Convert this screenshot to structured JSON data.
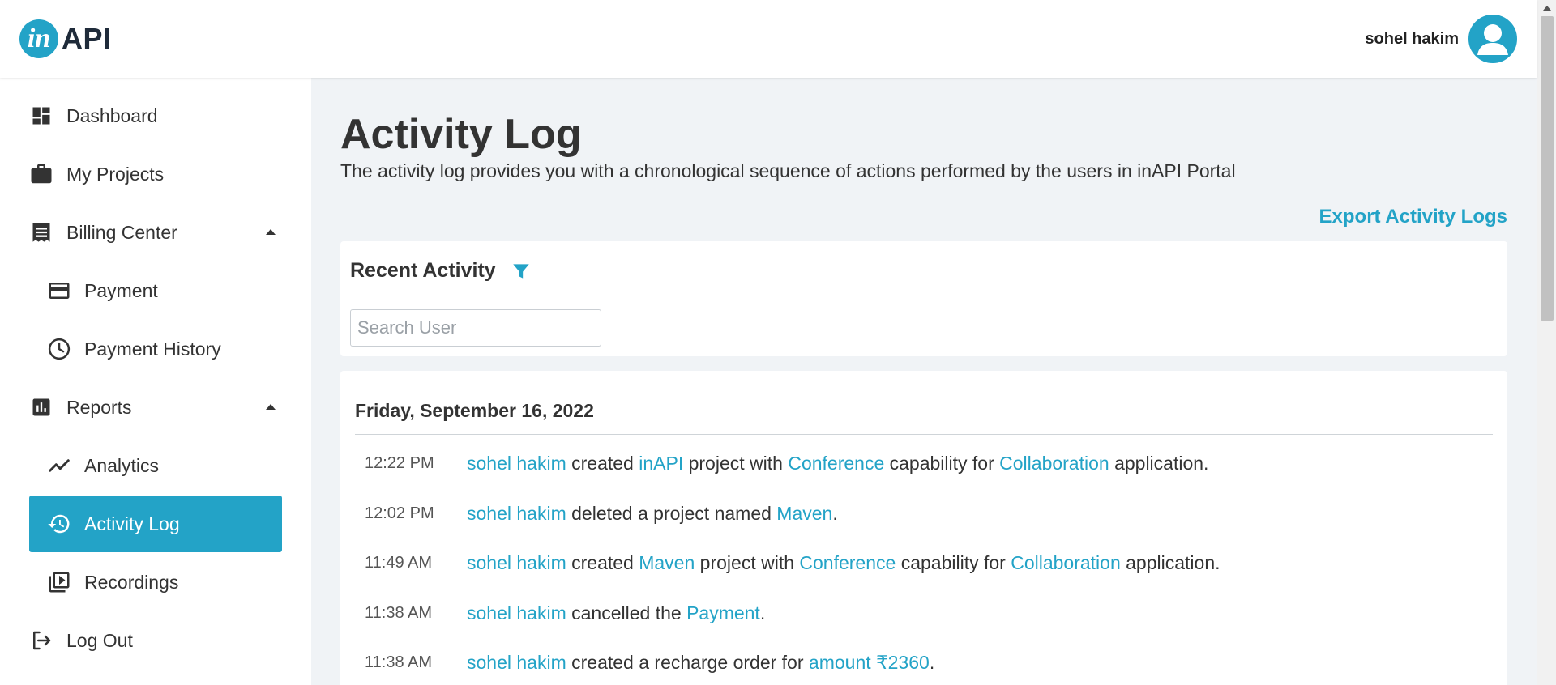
{
  "brand": {
    "logo_mark": "in",
    "logo_text": "API",
    "accent_color": "#23a3c7"
  },
  "user": {
    "name": "sohel hakim"
  },
  "sidebar": {
    "items": [
      {
        "label": "Dashboard",
        "icon": "dashboard-icon"
      },
      {
        "label": "My Projects",
        "icon": "briefcase-icon"
      },
      {
        "label": "Billing Center",
        "icon": "receipt-icon",
        "expanded": true
      },
      {
        "label": "Payment",
        "icon": "credit-card-icon"
      },
      {
        "label": "Payment History",
        "icon": "clock-icon"
      },
      {
        "label": "Reports",
        "icon": "bar-chart-icon",
        "expanded": true
      },
      {
        "label": "Analytics",
        "icon": "trend-line-icon"
      },
      {
        "label": "Activity Log",
        "icon": "history-icon",
        "active": true
      },
      {
        "label": "Recordings",
        "icon": "video-library-icon"
      },
      {
        "label": "Log Out",
        "icon": "logout-icon"
      }
    ]
  },
  "page": {
    "title": "Activity Log",
    "description": "The activity log provides you with a chronological sequence of actions performed by the users in inAPI Portal",
    "export_label": "Export Activity Logs"
  },
  "filter": {
    "title": "Recent Activity",
    "search_placeholder": "Search User"
  },
  "log": {
    "date": "Friday, September 16, 2022",
    "entries": [
      {
        "time": "12:22 PM",
        "parts": [
          "sohel hakim",
          " created ",
          "inAPI",
          " project with ",
          "Conference",
          " capability for ",
          "Collaboration",
          " application."
        ]
      },
      {
        "time": "12:02 PM",
        "parts": [
          "sohel hakim",
          " deleted a project named ",
          "Maven",
          "."
        ]
      },
      {
        "time": "11:49 AM",
        "parts": [
          "sohel hakim",
          " created ",
          "Maven",
          " project with ",
          "Conference",
          " capability for ",
          "Collaboration",
          " application."
        ]
      },
      {
        "time": "11:38 AM",
        "parts": [
          "sohel hakim",
          " cancelled the ",
          "Payment",
          "."
        ]
      },
      {
        "time": "11:38 AM",
        "parts": [
          "sohel hakim",
          " created a recharge order for ",
          "amount ₹2360",
          "."
        ]
      }
    ]
  }
}
